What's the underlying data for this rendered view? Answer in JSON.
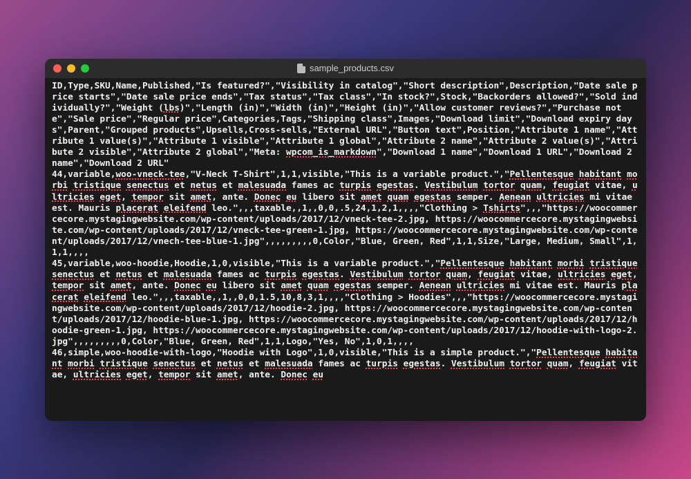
{
  "titlebar": {
    "filename": "sample_products.csv"
  },
  "segments": [
    {
      "t": "ID,Type,SKU,Name,Published,\"Is featured?\",\"Visibility in catalog\",\"Short description\",Description,\"Date sale price starts\",\"Date sale price ends\",\"Tax status\",\"Tax class\",\"In stock?\",Stock,\"Backorders allowed?\",\"Sold individually?\",\"Weight (",
      "s": false
    },
    {
      "t": "lbs",
      "s": true
    },
    {
      "t": ")\",\"Length (in)\",\"Width (in)\",\"Height (in)\",\"Allow customer reviews?\",\"Purchase note\",\"Sale price\",\"Regular price\",Categories,Tags,\"Shipping class\",Images,\"Download limit\",\"Download expiry days\",Parent,\"Grouped products\",Upsells,Cross-sells,\"External URL\",\"Button text\",Position,\"Attribute 1 name\",\"Attribute 1 value(s)\",\"Attribute 1 visible\",\"Attribute 1 global\",\"Attribute 2 name\",\"Attribute 2 value(s)\",\"Attribute 2 visible\",\"Attribute 2 global\",\"Meta: ",
      "s": false
    },
    {
      "t": "wpcom_is_markdown",
      "s": true
    },
    {
      "t": "\",\"Download 1 name\",\"Download 1 URL\",\"Download 2 name\",\"Download 2 URL\"\n44,variable,",
      "s": false
    },
    {
      "t": "woo-vneck-tee",
      "s": true
    },
    {
      "t": ",\"V-Neck T-Shirt\",1,1,visible,\"This is a variable product.\",\"",
      "s": false
    },
    {
      "t": "Pellentesque",
      "s": true
    },
    {
      "t": " ",
      "s": false
    },
    {
      "t": "habitant",
      "s": true
    },
    {
      "t": " ",
      "s": false
    },
    {
      "t": "morbi",
      "s": true
    },
    {
      "t": " ",
      "s": false
    },
    {
      "t": "tristique",
      "s": true
    },
    {
      "t": " ",
      "s": false
    },
    {
      "t": "senectus",
      "s": true
    },
    {
      "t": " et ",
      "s": false
    },
    {
      "t": "netus",
      "s": true
    },
    {
      "t": " et ",
      "s": false
    },
    {
      "t": "malesuada",
      "s": true
    },
    {
      "t": " fames ac ",
      "s": false
    },
    {
      "t": "turpis",
      "s": true
    },
    {
      "t": " ",
      "s": false
    },
    {
      "t": "egestas",
      "s": true
    },
    {
      "t": ". ",
      "s": false
    },
    {
      "t": "Vestibulum",
      "s": true
    },
    {
      "t": " ",
      "s": false
    },
    {
      "t": "tortor",
      "s": true
    },
    {
      "t": " ",
      "s": false
    },
    {
      "t": "quam",
      "s": true
    },
    {
      "t": ", ",
      "s": false
    },
    {
      "t": "feugiat",
      "s": true
    },
    {
      "t": " vitae, ",
      "s": false
    },
    {
      "t": "ultricies",
      "s": true
    },
    {
      "t": " ",
      "s": false
    },
    {
      "t": "eget",
      "s": true
    },
    {
      "t": ", ",
      "s": false
    },
    {
      "t": "tempor",
      "s": true
    },
    {
      "t": " sit ",
      "s": false
    },
    {
      "t": "amet",
      "s": true
    },
    {
      "t": ", ante. ",
      "s": false
    },
    {
      "t": "Donec",
      "s": true
    },
    {
      "t": " ",
      "s": false
    },
    {
      "t": "eu",
      "s": true
    },
    {
      "t": " libero sit ",
      "s": false
    },
    {
      "t": "amet",
      "s": true
    },
    {
      "t": " ",
      "s": false
    },
    {
      "t": "quam",
      "s": true
    },
    {
      "t": " ",
      "s": false
    },
    {
      "t": "egestas",
      "s": true
    },
    {
      "t": " semper. ",
      "s": false
    },
    {
      "t": "Aenean",
      "s": true
    },
    {
      "t": " ",
      "s": false
    },
    {
      "t": "ultricies",
      "s": true
    },
    {
      "t": " mi vitae est. Mauris ",
      "s": false
    },
    {
      "t": "placerat",
      "s": true
    },
    {
      "t": " ",
      "s": false
    },
    {
      "t": "eleifend",
      "s": true
    },
    {
      "t": " leo.\",,,taxable,,1,,0,0,.5,24,1,2,1,,,,\"Clothing > ",
      "s": false
    },
    {
      "t": "Tshirts",
      "s": true
    },
    {
      "t": "\",,,\"https://woocommercecore.mystagingwebsite.com/wp-content/uploads/2017/12/vneck-tee-2.jpg, https://woocommercecore.mystagingwebsite.com/wp-content/uploads/2017/12/vneck-tee-green-1.jpg, https://woocommercecore.mystagingwebsite.com/wp-content/uploads/2017/12/vnech-tee-blue-1.jpg\",,,,,,,,,0,Color,\"Blue, Green, Red\",1,1,Size,\"Large, Medium, Small\",1,1,1,,,,\n45,variable,woo-hoodie,Hoodie,1,0,visible,\"This is a variable product.\",\"",
      "s": false
    },
    {
      "t": "Pellentesque",
      "s": true
    },
    {
      "t": " ",
      "s": false
    },
    {
      "t": "habitant",
      "s": true
    },
    {
      "t": " ",
      "s": false
    },
    {
      "t": "morbi",
      "s": true
    },
    {
      "t": " ",
      "s": false
    },
    {
      "t": "tristique",
      "s": true
    },
    {
      "t": " ",
      "s": false
    },
    {
      "t": "senectus",
      "s": true
    },
    {
      "t": " et ",
      "s": false
    },
    {
      "t": "netus",
      "s": true
    },
    {
      "t": " et ",
      "s": false
    },
    {
      "t": "malesuada",
      "s": true
    },
    {
      "t": " fames ac ",
      "s": false
    },
    {
      "t": "turpis",
      "s": true
    },
    {
      "t": " ",
      "s": false
    },
    {
      "t": "egestas",
      "s": true
    },
    {
      "t": ". ",
      "s": false
    },
    {
      "t": "Vestibulum",
      "s": true
    },
    {
      "t": " ",
      "s": false
    },
    {
      "t": "tortor",
      "s": true
    },
    {
      "t": " ",
      "s": false
    },
    {
      "t": "quam",
      "s": true
    },
    {
      "t": ", ",
      "s": false
    },
    {
      "t": "feugiat",
      "s": true
    },
    {
      "t": " vitae, ",
      "s": false
    },
    {
      "t": "ultricies",
      "s": true
    },
    {
      "t": " ",
      "s": false
    },
    {
      "t": "eget",
      "s": true
    },
    {
      "t": ", ",
      "s": false
    },
    {
      "t": "tempor",
      "s": true
    },
    {
      "t": " sit ",
      "s": false
    },
    {
      "t": "amet",
      "s": true
    },
    {
      "t": ", ante. ",
      "s": false
    },
    {
      "t": "Donec",
      "s": true
    },
    {
      "t": " ",
      "s": false
    },
    {
      "t": "eu",
      "s": true
    },
    {
      "t": " libero sit ",
      "s": false
    },
    {
      "t": "amet",
      "s": true
    },
    {
      "t": " ",
      "s": false
    },
    {
      "t": "quam",
      "s": true
    },
    {
      "t": " ",
      "s": false
    },
    {
      "t": "egestas",
      "s": true
    },
    {
      "t": " semper. ",
      "s": false
    },
    {
      "t": "Aenean",
      "s": true
    },
    {
      "t": " ",
      "s": false
    },
    {
      "t": "ultricies",
      "s": true
    },
    {
      "t": " mi vitae est. Mauris ",
      "s": false
    },
    {
      "t": "placerat",
      "s": true
    },
    {
      "t": " ",
      "s": false
    },
    {
      "t": "eleifend",
      "s": true
    },
    {
      "t": " leo.\",,,taxable,,1,,0,0,1.5,10,8,3,1,,,,\"Clothing > Hoodies\",,,\"https://woocommercecore.mystagingwebsite.com/wp-content/uploads/2017/12/hoodie-2.jpg, https://woocommercecore.mystagingwebsite.com/wp-content/uploads/2017/12/hoodie-blue-1.jpg, https://woocommercecore.mystagingwebsite.com/wp-content/uploads/2017/12/hoodie-green-1.jpg, https://woocommercecore.mystagingwebsite.com/wp-content/uploads/2017/12/hoodie-with-logo-2.jpg\",,,,,,,,,0,Color,\"Blue, Green, Red\",1,1,Logo,\"Yes, No\",1,0,1,,,,\n46,simple,woo-hoodie-with-logo,\"Hoodie with Logo\",1,0,visible,\"This is a simple product.\",\"",
      "s": false
    },
    {
      "t": "Pellentesque",
      "s": true
    },
    {
      "t": " ",
      "s": false
    },
    {
      "t": "habitant",
      "s": true
    },
    {
      "t": " ",
      "s": false
    },
    {
      "t": "morbi",
      "s": true
    },
    {
      "t": " ",
      "s": false
    },
    {
      "t": "tristique",
      "s": true
    },
    {
      "t": " ",
      "s": false
    },
    {
      "t": "senectus",
      "s": true
    },
    {
      "t": " et ",
      "s": false
    },
    {
      "t": "netus",
      "s": true
    },
    {
      "t": " et ",
      "s": false
    },
    {
      "t": "malesuada",
      "s": true
    },
    {
      "t": " fames ac ",
      "s": false
    },
    {
      "t": "turpis",
      "s": true
    },
    {
      "t": " ",
      "s": false
    },
    {
      "t": "egestas",
      "s": true
    },
    {
      "t": ". ",
      "s": false
    },
    {
      "t": "Vestibulum",
      "s": true
    },
    {
      "t": " ",
      "s": false
    },
    {
      "t": "tortor",
      "s": true
    },
    {
      "t": " ",
      "s": false
    },
    {
      "t": "quam",
      "s": true
    },
    {
      "t": ", ",
      "s": false
    },
    {
      "t": "feugiat",
      "s": true
    },
    {
      "t": " vitae, ",
      "s": false
    },
    {
      "t": "ultricies",
      "s": true
    },
    {
      "t": " ",
      "s": false
    },
    {
      "t": "eget",
      "s": true
    },
    {
      "t": ", ",
      "s": false
    },
    {
      "t": "tempor",
      "s": true
    },
    {
      "t": " sit ",
      "s": false
    },
    {
      "t": "amet",
      "s": true
    },
    {
      "t": ", ante. ",
      "s": false
    },
    {
      "t": "Donec",
      "s": true
    },
    {
      "t": " ",
      "s": false
    },
    {
      "t": "eu",
      "s": true
    }
  ]
}
